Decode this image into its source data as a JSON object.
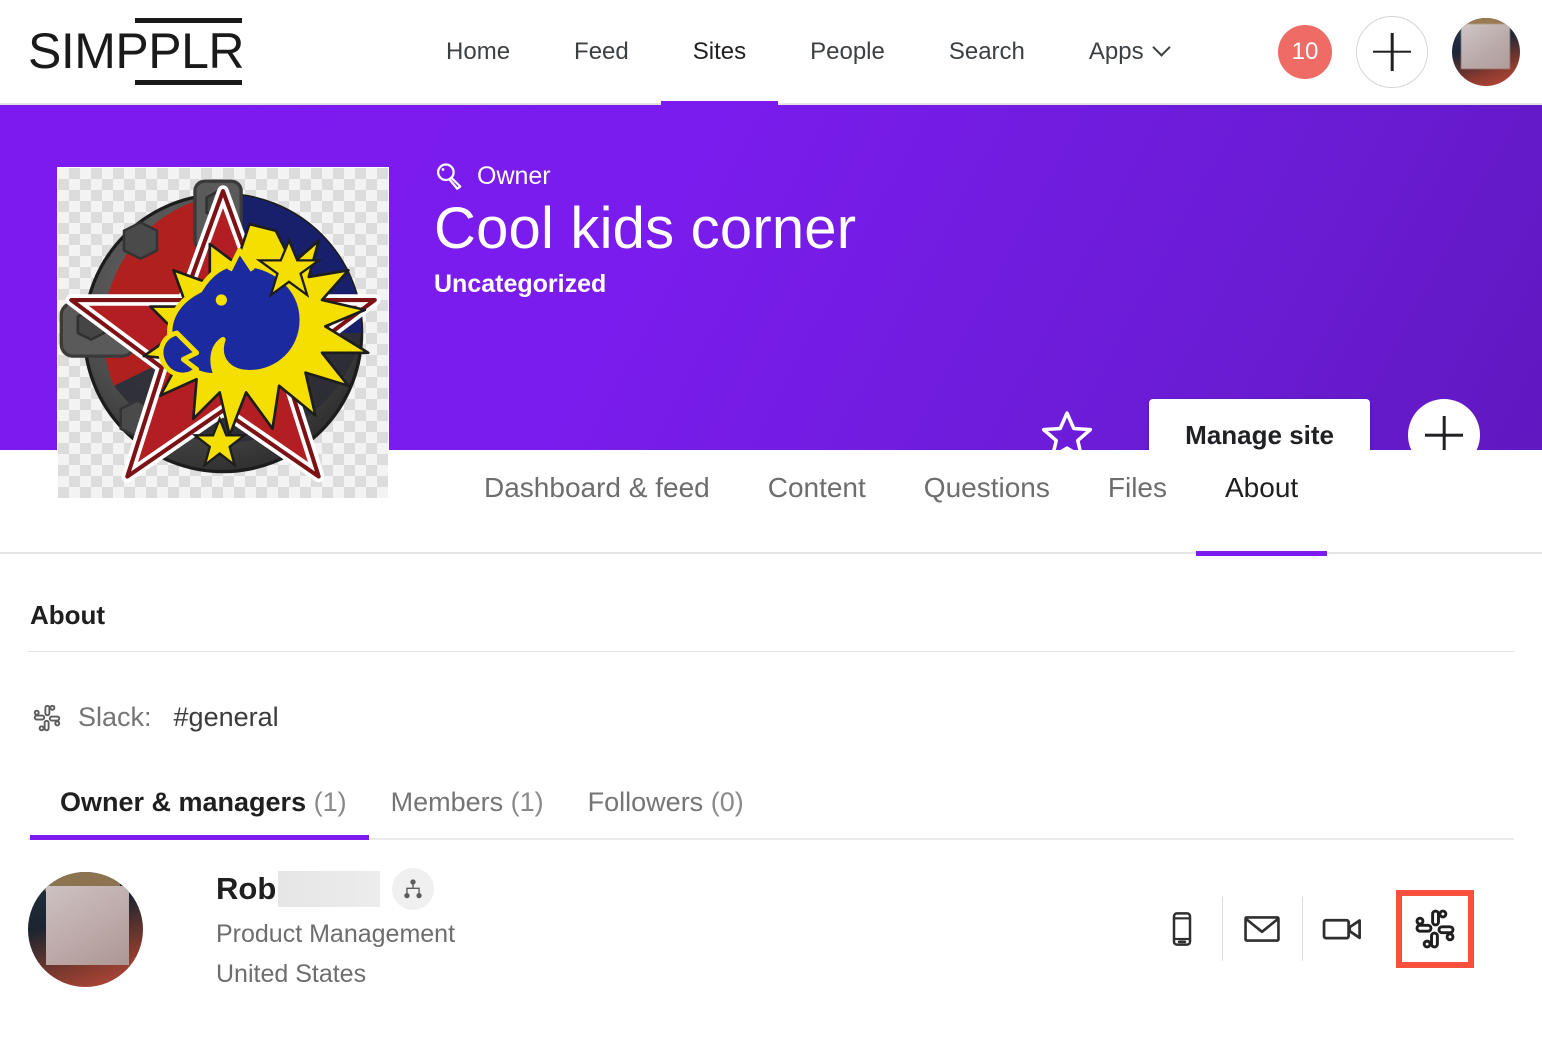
{
  "header": {
    "logo_text": "SIMPPLR",
    "nav": [
      {
        "label": "Home",
        "active": false
      },
      {
        "label": "Feed",
        "active": false
      },
      {
        "label": "Sites",
        "active": true
      },
      {
        "label": "People",
        "active": false
      },
      {
        "label": "Search",
        "active": false
      },
      {
        "label": "Apps",
        "active": false,
        "has_chevron": true
      }
    ],
    "notification_count": "10",
    "add_icon": "plus-icon",
    "avatar_icon": "user-avatar",
    "accent_color": "#7c1af0",
    "badge_color": "#ef6b66"
  },
  "banner": {
    "visibility_icon": "magnifying-glass-icon",
    "visibility_label": "Owner",
    "site_name": "Cool kids corner",
    "site_category": "Uncategorized",
    "favorite_icon": "star-outline-icon",
    "manage_button_label": "Manage site",
    "add_button_icon": "plus-icon",
    "gradient_start": "#7c1af0",
    "gradient_end": "#6018c0",
    "site_logo_alt": "wolf-star-badge-logo"
  },
  "site_tabs": [
    {
      "label": "Dashboard & feed",
      "active": false
    },
    {
      "label": "Content",
      "active": false
    },
    {
      "label": "Questions",
      "active": false
    },
    {
      "label": "Files",
      "active": false
    },
    {
      "label": "About",
      "active": true
    }
  ],
  "about": {
    "section_title": "About",
    "slack": {
      "icon": "slack-icon",
      "label": "Slack:",
      "channel": "#general"
    },
    "subtabs": [
      {
        "label": "Owner & managers",
        "count": "(1)",
        "active": true
      },
      {
        "label": "Members",
        "count": "(1)",
        "active": false
      },
      {
        "label": "Followers",
        "count": "(0)",
        "active": false
      }
    ],
    "people": [
      {
        "name": "Rob",
        "name_redacted": true,
        "org_chart_icon": "org-chart-icon",
        "department": "Product Management",
        "location": "United States",
        "actions": [
          {
            "icon": "mobile-phone-icon",
            "highlighted": false
          },
          {
            "icon": "envelope-icon",
            "highlighted": false
          },
          {
            "icon": "video-camera-icon",
            "highlighted": false
          },
          {
            "icon": "slack-icon",
            "highlighted": true
          }
        ]
      }
    ],
    "highlight_color": "#f8503c"
  }
}
